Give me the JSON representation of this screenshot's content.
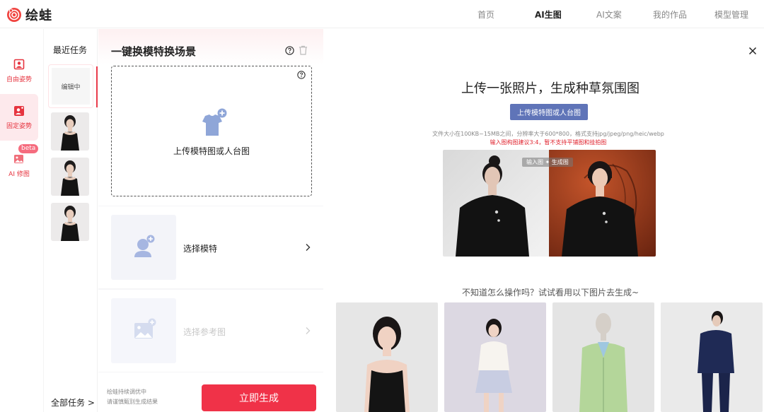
{
  "app": {
    "name": "绘蛙"
  },
  "nav": {
    "items": [
      {
        "label": "首页",
        "active": false
      },
      {
        "label": "AI生图",
        "active": true
      },
      {
        "label": "AI文案",
        "active": false
      },
      {
        "label": "我的作品",
        "active": false
      },
      {
        "label": "模型管理",
        "active": false
      }
    ]
  },
  "sidebar": {
    "items": [
      {
        "label": "自由姿势",
        "icon": "person-frame-icon",
        "active": false
      },
      {
        "label": "固定姿势",
        "icon": "person-card-icon",
        "active": true
      },
      {
        "label": "AI 修图",
        "icon": "image-edit-icon",
        "badge": "beta",
        "active": false
      }
    ]
  },
  "tasks": {
    "title": "最近任务",
    "editing_label": "编辑中",
    "all_label": "全部任务 >"
  },
  "form": {
    "title": "一键换模特换场景",
    "upload_label": "上传模特图或人台图",
    "select_model": "选择模特",
    "select_reference": "选择参考图",
    "hint_line1": "绘蛙持续调优中",
    "hint_line2": "请谨慎甄别生成结果",
    "generate_label": "立即生成"
  },
  "main": {
    "headline": "上传一张照片，生成种草氛围图",
    "upload_button": "上传模特图或人台图",
    "spec": "文件大小在100KB~15MB之间，分辨率大于600*800，格式支持jpg/jpeg/png/heic/webp",
    "spec_warning": "输入图构图建议3:4，暂不支持平铺图和挂拍图",
    "demo_label": "输入图 ✦ 生成图",
    "try_hint": "不知道怎么操作吗？试试看用以下图片去生成~"
  },
  "colors": {
    "brand_red": "#f03248",
    "upload_blue": "#5f74b8",
    "warning_red": "#e0242f"
  }
}
